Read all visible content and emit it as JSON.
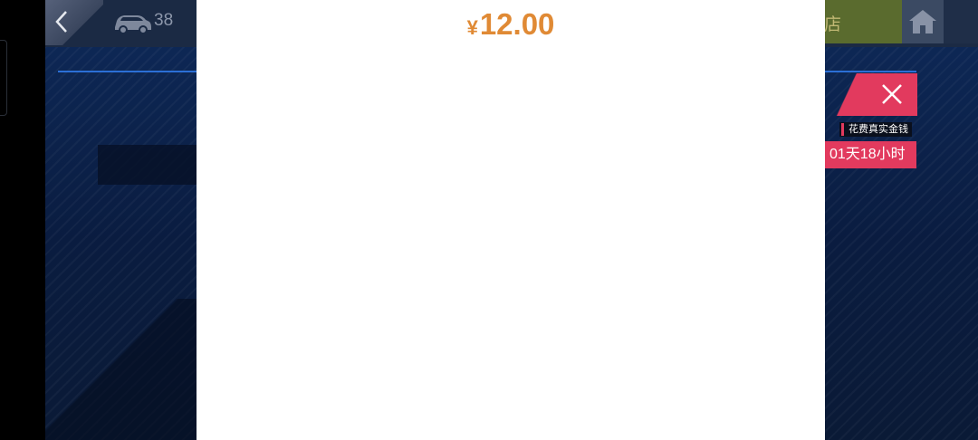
{
  "topbar": {
    "car_count": "38",
    "shop_label": "店"
  },
  "offer": {
    "cost_notice": "花费真实金钱",
    "timer": "01天18小时"
  },
  "payment": {
    "currency_symbol": "¥",
    "amount": "12.00"
  },
  "icons": {
    "back": "chevron-left-icon",
    "car": "car-icon",
    "home": "home-icon",
    "close": "close-icon"
  },
  "colors": {
    "accent_pink": "#e23a5e",
    "price_orange": "#e08a35",
    "shop_green": "#5a6b2e"
  }
}
